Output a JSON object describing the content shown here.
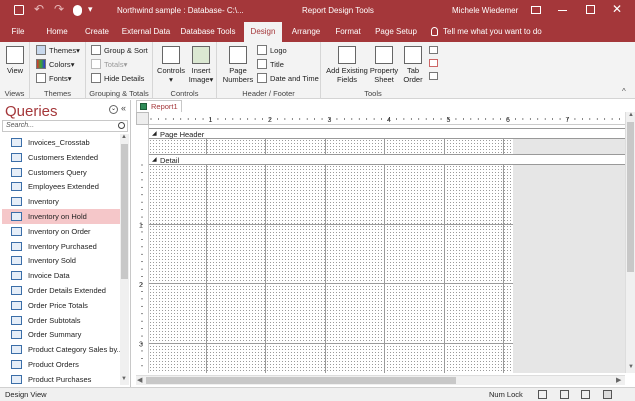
{
  "titlebar": {
    "doc_title": "Northwind sample : Database- C:\\...",
    "context": "Report Design Tools",
    "user": "Michele Wiedemer",
    "bg_color": "#a4373a"
  },
  "tabs": [
    {
      "label": "File"
    },
    {
      "label": "Home"
    },
    {
      "label": "Create"
    },
    {
      "label": "External Data"
    },
    {
      "label": "Database Tools"
    },
    {
      "label": "Design"
    },
    {
      "label": "Arrange"
    },
    {
      "label": "Format"
    },
    {
      "label": "Page Setup"
    }
  ],
  "tellme": "Tell me what you want to do",
  "ribbon": {
    "views": {
      "label": "Views",
      "view_btn": "View"
    },
    "themes": {
      "label": "Themes",
      "themes_btn": "Themes",
      "colors_btn": "Colors",
      "fonts_btn": "Fonts"
    },
    "grouping": {
      "label": "Grouping & Totals",
      "group_sort": "Group & Sort",
      "totals": "Totals",
      "hide_details": "Hide Details"
    },
    "controls": {
      "label": "Controls",
      "controls_btn": "Controls",
      "insert_image": "Insert Image"
    },
    "header_footer": {
      "label": "Header / Footer",
      "page_numbers": "Page Numbers",
      "logo": "Logo",
      "title": "Title",
      "date_time": "Date and Time"
    },
    "tools": {
      "label": "Tools",
      "add_fields": "Add Existing Fields",
      "property_sheet": "Property Sheet",
      "tab_order": "Tab Order"
    }
  },
  "nav": {
    "title": "Queries",
    "search_placeholder": "Search...",
    "items": [
      {
        "label": "Invoices_Crosstab"
      },
      {
        "label": "Customers Extended"
      },
      {
        "label": "Customers Query"
      },
      {
        "label": "Employees Extended"
      },
      {
        "label": "Inventory"
      },
      {
        "label": "Inventory on Hold"
      },
      {
        "label": "Inventory on Order"
      },
      {
        "label": "Inventory Purchased"
      },
      {
        "label": "Inventory Sold"
      },
      {
        "label": "Invoice Data"
      },
      {
        "label": "Order Details Extended"
      },
      {
        "label": "Order Price Totals"
      },
      {
        "label": "Order Subtotals"
      },
      {
        "label": "Order Summary"
      },
      {
        "label": "Product Category Sales by..."
      },
      {
        "label": "Product Orders"
      },
      {
        "label": "Product Purchases"
      }
    ],
    "selected_index": 5
  },
  "document": {
    "tab_label": "Report1",
    "page_header_label": "Page Header",
    "detail_label": "Detail"
  },
  "ruler_numbers": [
    "1",
    "2",
    "3",
    "4",
    "5",
    "6",
    "7"
  ],
  "vruler_numbers": [
    "1",
    "2",
    "3"
  ],
  "status": {
    "left": "Design View",
    "num_lock": "Num Lock"
  }
}
